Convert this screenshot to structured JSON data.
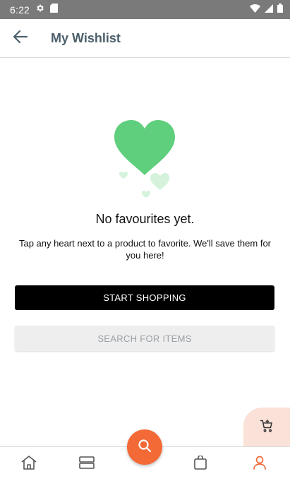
{
  "status_bar": {
    "time": "6:22"
  },
  "app_bar": {
    "title": "My Wishlist"
  },
  "empty_state": {
    "title": "No favourites yet.",
    "description": "Tap any heart next to a product to favorite. We'll save them for you here!"
  },
  "actions": {
    "start_shopping": "START SHOPPING",
    "search_items": "SEARCH FOR ITEMS"
  },
  "colors": {
    "accent": "#f46a36",
    "heart": "#5fcf7d",
    "title": "#4b5f6b"
  },
  "bottom_nav": {
    "items": [
      "home-icon",
      "categories-icon",
      "search-icon",
      "bag-icon",
      "profile-icon"
    ],
    "active": "profile-icon"
  }
}
